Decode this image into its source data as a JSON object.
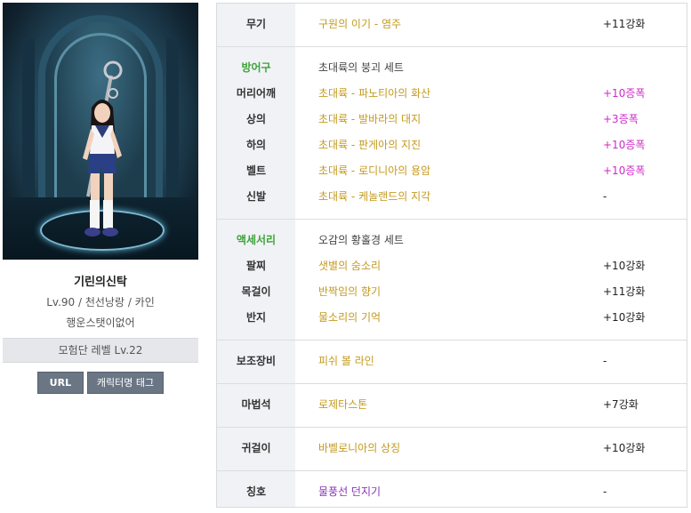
{
  "profile": {
    "name": "기린의신탁",
    "info": "Lv.90 / 천선낭랑 / 카인",
    "guild": "행운스탯이없어",
    "adventure_level": "모험단 레벨 Lv.22",
    "url_button": "URL",
    "tag_button": "캐릭터명 태그"
  },
  "equipment": {
    "weapon": {
      "label": "무기",
      "name": "구원의 이기 - 염주",
      "enhance": "+11강화"
    },
    "armor_header": {
      "label": "방어구",
      "set": "초대륙의 붕괴 세트"
    },
    "armor": [
      {
        "label": "머리어깨",
        "name": "초대륙 - 파노티아의 화산",
        "enhance": "+10증폭"
      },
      {
        "label": "상의",
        "name": "초대륙 - 발바라의 대지",
        "enhance": "+3증폭"
      },
      {
        "label": "하의",
        "name": "초대륙 - 판게아의 지진",
        "enhance": "+10증폭"
      },
      {
        "label": "벨트",
        "name": "초대륙 - 로디니아의 용암",
        "enhance": "+10증폭"
      },
      {
        "label": "신발",
        "name": "초대륙 - 케놀랜드의 지각",
        "enhance": "-"
      }
    ],
    "accessory_header": {
      "label": "액세서리",
      "set": "오감의 황홀경 세트"
    },
    "accessories": [
      {
        "label": "팔찌",
        "name": "샛별의 숨소리",
        "enhance": "+10강화"
      },
      {
        "label": "목걸이",
        "name": "반짝임의 향기",
        "enhance": "+11강화"
      },
      {
        "label": "반지",
        "name": "물소리의 기억",
        "enhance": "+10강화"
      }
    ],
    "sub": {
      "label": "보조장비",
      "name": "피쉬 볼 라인",
      "enhance": "-"
    },
    "magic_stone": {
      "label": "마법석",
      "name": "로제타스톤",
      "enhance": "+7강화"
    },
    "earring": {
      "label": "귀걸이",
      "name": "바벨로니아의 상징",
      "enhance": "+10강화"
    },
    "title": {
      "label": "칭호",
      "name": "물풍선 던지기",
      "enhance": "-"
    }
  },
  "colors": {
    "item_name": "#c49a1e",
    "set_label": "#3da33a",
    "amplify": "#cf2ac9",
    "title_item": "#8a35b8",
    "label_column": "#f0f2f5"
  }
}
